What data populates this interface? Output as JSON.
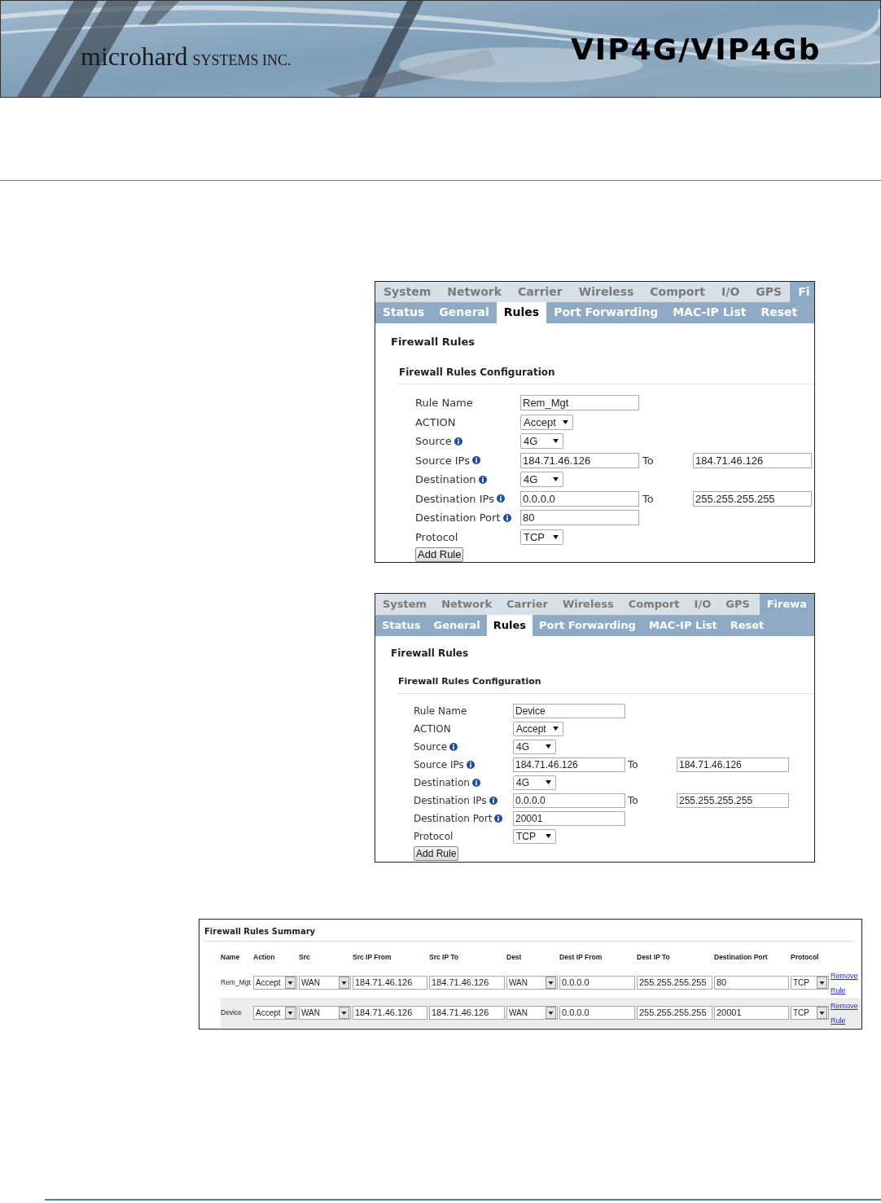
{
  "header": {
    "logo": "microhard",
    "logo_suffix": "SYSTEMS INC.",
    "product": "VIP4G/VIP4Gb"
  },
  "panels": [
    {
      "main_tabs": [
        {
          "label": "System",
          "selected": false
        },
        {
          "label": "Network",
          "selected": false
        },
        {
          "label": "Carrier",
          "selected": false
        },
        {
          "label": "Wireless",
          "selected": false
        },
        {
          "label": "Comport",
          "selected": false
        },
        {
          "label": "I/O",
          "selected": false
        },
        {
          "label": "GPS",
          "selected": false
        },
        {
          "label": "Fi",
          "selected": true
        }
      ],
      "sub_tabs": [
        {
          "label": "Status",
          "selected": false
        },
        {
          "label": "General",
          "selected": false
        },
        {
          "label": "Rules",
          "selected": true
        },
        {
          "label": "Port Forwarding",
          "selected": false
        },
        {
          "label": "MAC-IP List",
          "selected": false
        },
        {
          "label": "Reset",
          "selected": false
        }
      ],
      "title": "Firewall Rules",
      "section": "Firewall Rules Configuration",
      "fields": [
        {
          "label": "Rule Name",
          "info": false,
          "kind": "text",
          "value": "Rem_Mgt"
        },
        {
          "label": "ACTION",
          "info": false,
          "kind": "select",
          "value": "Accept"
        },
        {
          "label": "Source",
          "info": true,
          "kind": "select",
          "value": "4G"
        },
        {
          "label": "Source IPs",
          "info": true,
          "kind": "range",
          "value": "184.71.46.126",
          "joiner": "To",
          "value_to": "184.71.46.126"
        },
        {
          "label": "Destination",
          "info": true,
          "kind": "select",
          "value": "4G"
        },
        {
          "label": "Destination IPs",
          "info": true,
          "kind": "range",
          "value": "0.0.0.0",
          "joiner": "To",
          "value_to": "255.255.255.255"
        },
        {
          "label": "Destination Port",
          "info": true,
          "kind": "text",
          "value": "80"
        },
        {
          "label": "Protocol",
          "info": false,
          "kind": "select",
          "value": "TCP"
        }
      ],
      "button": "Add Rule"
    },
    {
      "main_tabs": [
        {
          "label": "System",
          "selected": false
        },
        {
          "label": "Network",
          "selected": false
        },
        {
          "label": "Carrier",
          "selected": false
        },
        {
          "label": "Wireless",
          "selected": false
        },
        {
          "label": "Comport",
          "selected": false
        },
        {
          "label": "I/O",
          "selected": false
        },
        {
          "label": "GPS",
          "selected": false
        },
        {
          "label": "Firewa",
          "selected": true
        }
      ],
      "sub_tabs": [
        {
          "label": "Status",
          "selected": false
        },
        {
          "label": "General",
          "selected": false
        },
        {
          "label": "Rules",
          "selected": true
        },
        {
          "label": "Port Forwarding",
          "selected": false
        },
        {
          "label": "MAC-IP List",
          "selected": false
        },
        {
          "label": "Reset",
          "selected": false
        }
      ],
      "title": "Firewall Rules",
      "section": "Firewall Rules Configuration",
      "fields": [
        {
          "label": "Rule Name",
          "info": false,
          "kind": "text",
          "value": "Device"
        },
        {
          "label": "ACTION",
          "info": false,
          "kind": "select",
          "value": "Accept"
        },
        {
          "label": "Source",
          "info": true,
          "kind": "select",
          "value": "4G"
        },
        {
          "label": "Source IPs",
          "info": true,
          "kind": "range",
          "value": "184.71.46.126",
          "joiner": "To",
          "value_to": "184.71.46.126"
        },
        {
          "label": "Destination",
          "info": true,
          "kind": "select",
          "value": "4G"
        },
        {
          "label": "Destination IPs",
          "info": true,
          "kind": "range",
          "value": "0.0.0.0",
          "joiner": "To",
          "value_to": "255.255.255.255"
        },
        {
          "label": "Destination Port",
          "info": true,
          "kind": "text",
          "value": "20001"
        },
        {
          "label": "Protocol",
          "info": false,
          "kind": "select",
          "value": "TCP"
        }
      ],
      "button": "Add Rule"
    }
  ],
  "summary": {
    "title": "Firewall Rules Summary",
    "columns": [
      "Name",
      "Action",
      "Src",
      "Src IP From",
      "Src IP To",
      "Dest",
      "Dest IP From",
      "Dest IP To",
      "Destination Port",
      "Protocol"
    ],
    "rows": [
      {
        "name": "Rem_Mgt",
        "action": "Accept",
        "src": "WAN",
        "src_ip_from": "184.71.46.126",
        "src_ip_to": "184.71.46.126",
        "dest": "WAN",
        "dest_ip_from": "0.0.0.0",
        "dest_ip_to": "255.255.255.255",
        "port": "80",
        "protocol": "TCP",
        "link": "Remove Rule"
      },
      {
        "name": "Device",
        "action": "Accept",
        "src": "WAN",
        "src_ip_from": "184.71.46.126",
        "src_ip_to": "184.71.46.126",
        "dest": "WAN",
        "dest_ip_from": "0.0.0.0",
        "dest_ip_to": "255.255.255.255",
        "port": "20001",
        "protocol": "TCP",
        "link": "Remove Rule"
      }
    ]
  }
}
